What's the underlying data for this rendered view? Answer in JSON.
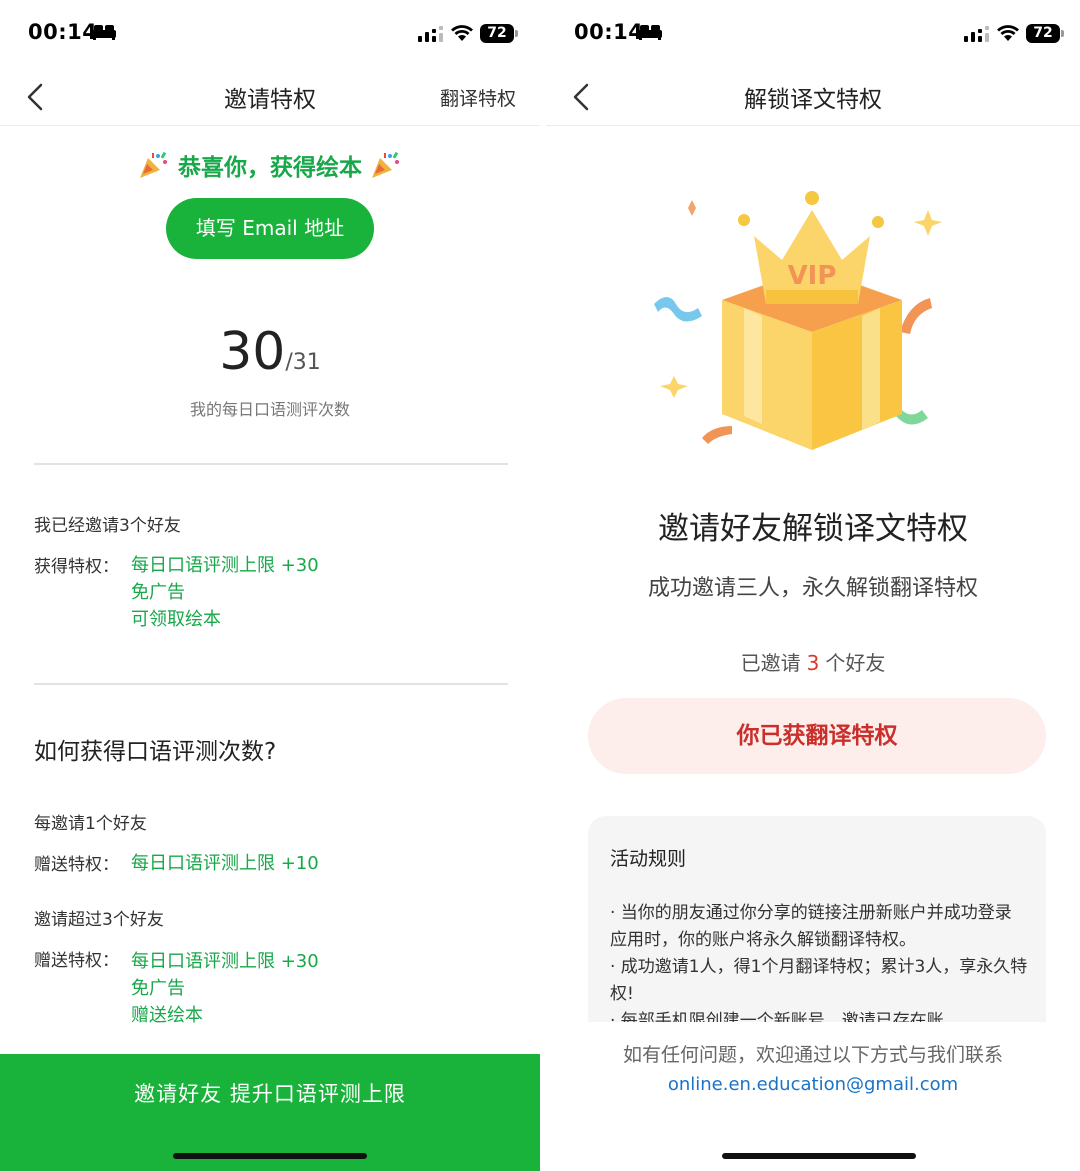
{
  "left": {
    "status": {
      "time": "00:14",
      "battery": "72"
    },
    "nav": {
      "title": "邀请特权",
      "right_link": "翻译特权"
    },
    "congrats_text": "恭喜你，获得绘本",
    "email_button": "填写 Email 地址",
    "count": {
      "current": "30",
      "total": "/31",
      "label": "我的每日口语测评次数"
    },
    "invited_summary": "我已经邀请3个好友",
    "privilege_label": "获得特权：",
    "privileges": [
      "每日口语评测上限 +30",
      "免广告",
      "可领取绘本"
    ],
    "howto": {
      "title": "如何获得口语评测次数?",
      "rule1_title": "每邀请1个好友",
      "rule1_label": "赠送特权：",
      "rule1_items": [
        "每日口语评测上限 +10"
      ],
      "rule2_title": "邀请超过3个好友",
      "rule2_label": "赠送特权：",
      "rule2_items": [
        "每日口语评测上限 +30",
        "免广告",
        "赠送绘本"
      ]
    },
    "invite_button": "邀请好友 提升口语评测上限"
  },
  "right": {
    "status": {
      "time": "00:14",
      "battery": "72"
    },
    "nav": {
      "title": "解锁译文特权"
    },
    "gift_badge": "VIP",
    "title": "邀请好友解锁译文特权",
    "subtitle": "成功邀请三人，永久解锁翻译特权",
    "invited_prefix": "已邀请",
    "invited_count": "3",
    "invited_suffix": "个好友",
    "status_button": "你已获翻译特权",
    "rules": {
      "title": "活动规则",
      "items": [
        "· 当你的朋友通过你分享的链接注册新账户并成功登录应用时，你的账户将永久解锁翻译特权。",
        "· 成功邀请1人，得1个月翻译特权；累计3人，享永久特权!",
        "· 每部手机限创建一个新账号，邀请已存在账"
      ]
    },
    "contact_text": "如有任何问题，欢迎通过以下方式与我们联系",
    "contact_email": "online.en.education@gmail.com"
  },
  "colors": {
    "primary_green": "#19b23b",
    "text_green": "#18a84a",
    "accent_red": "#c9302c",
    "link_blue": "#1a73c8"
  }
}
